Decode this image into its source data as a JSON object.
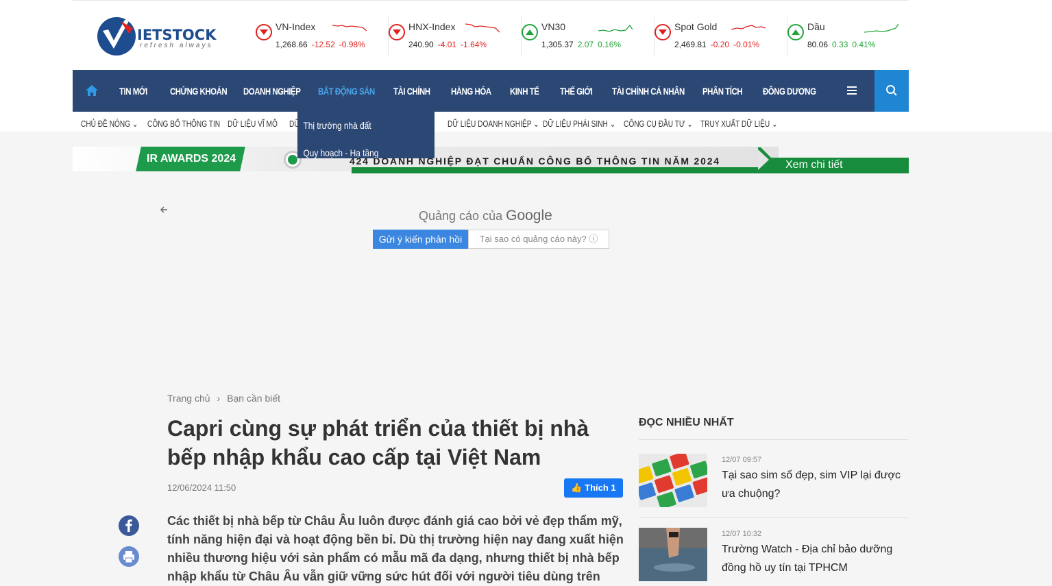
{
  "brand": {
    "name": "IETSTOCK",
    "tagline": "refresh always"
  },
  "tickers": [
    {
      "name": "VN-Index",
      "value": "1,268.66",
      "change": "-12.52",
      "pct": "-0.98%",
      "dir": "down"
    },
    {
      "name": "HNX-Index",
      "value": "240.90",
      "change": "-4.01",
      "pct": "-1.64%",
      "dir": "down"
    },
    {
      "name": "VN30",
      "value": "1,305.37",
      "change": "2.07",
      "pct": "0.16%",
      "dir": "up"
    },
    {
      "name": "Spot Gold",
      "value": "2,469.81",
      "change": "-0.20",
      "pct": "-0.01%",
      "dir": "down"
    },
    {
      "name": "Dầu",
      "value": "80.06",
      "change": "0.33",
      "pct": "0.41%",
      "dir": "up"
    }
  ],
  "nav": {
    "items": [
      "TIN MỚI",
      "CHỨNG KHOÁN",
      "DOANH NGHIỆP",
      "BẤT ĐỘNG SẢN",
      "TÀI CHÍNH",
      "HÀNG HÓA",
      "KINH TẾ",
      "THẾ GIỚI",
      "TÀI CHÍNH CÁ NHÂN",
      "PHÂN TÍCH",
      "ĐÔNG DƯƠNG"
    ],
    "active": "BẤT ĐỘNG SẢN",
    "dropdown": [
      "Thị trường nhà đất",
      "Quy hoạch - Hạ tầng"
    ]
  },
  "subnav": [
    "CHỦ ĐỀ NÓNG",
    "CÔNG BỐ THÔNG TIN",
    "DỮ LIỆU VĨ MÔ",
    "DỮ",
    "DỮ LIỆU DOANH NGHIỆP",
    "DỮ LIỆU PHÁI SINH",
    "CÔNG CỤ ĐẦU TƯ",
    "TRUY XUẤT DỮ LIỆU"
  ],
  "banner": {
    "award": "IR AWARDS 2024",
    "text": "424 DOANH NGHIỆP ĐẠT CHUẨN CÔNG BỐ THÔNG TIN NĂM 2024",
    "cta": "Xem chi tiết"
  },
  "ad": {
    "label_prefix": "Quảng cáo của",
    "label_brand": "Google",
    "feedback": "Gửi ý kiến phản hồi",
    "why": "Tại sao có quảng cáo này? ⓘ"
  },
  "article": {
    "breadcrumb": [
      "Trang chủ",
      "Bạn cần biết"
    ],
    "title": "Capri cùng sự phát triển của thiết bị nhà bếp nhập khẩu cao cấp tại Việt Nam",
    "date": "12/06/2024 11:50",
    "like": "Thích 1",
    "lead": "Các thiết bị nhà bếp từ Châu Âu luôn được đánh giá cao bởi vẻ đẹp thẩm mỹ, tính năng hiện đại và hoạt động bền bỉ. Dù thị trường hiện nay đang xuất hiện nhiều thương hiệu với sản phẩm có mẫu mã đa dạng, nhưng thiết bị nhà bếp nhập khẩu từ Châu Âu vẫn giữ vững sức hút đối với người tiêu dùng trên"
  },
  "sidebar": {
    "title": "ĐỌC NHIỀU NHẤT",
    "items": [
      {
        "time": "12/07 09:57",
        "title": "Tại sao sim số đẹp, sim VIP lại được ưa chuộng?"
      },
      {
        "time": "12/07 10:32",
        "title": "Trường Watch - Địa chỉ bảo dưỡng đồng hồ uy tín tại TPHCM"
      }
    ]
  },
  "colors": {
    "nav": "#2b4774",
    "accent": "#1f86d4",
    "down": "#e02020",
    "up": "#21a43a",
    "green": "#168c3c"
  }
}
